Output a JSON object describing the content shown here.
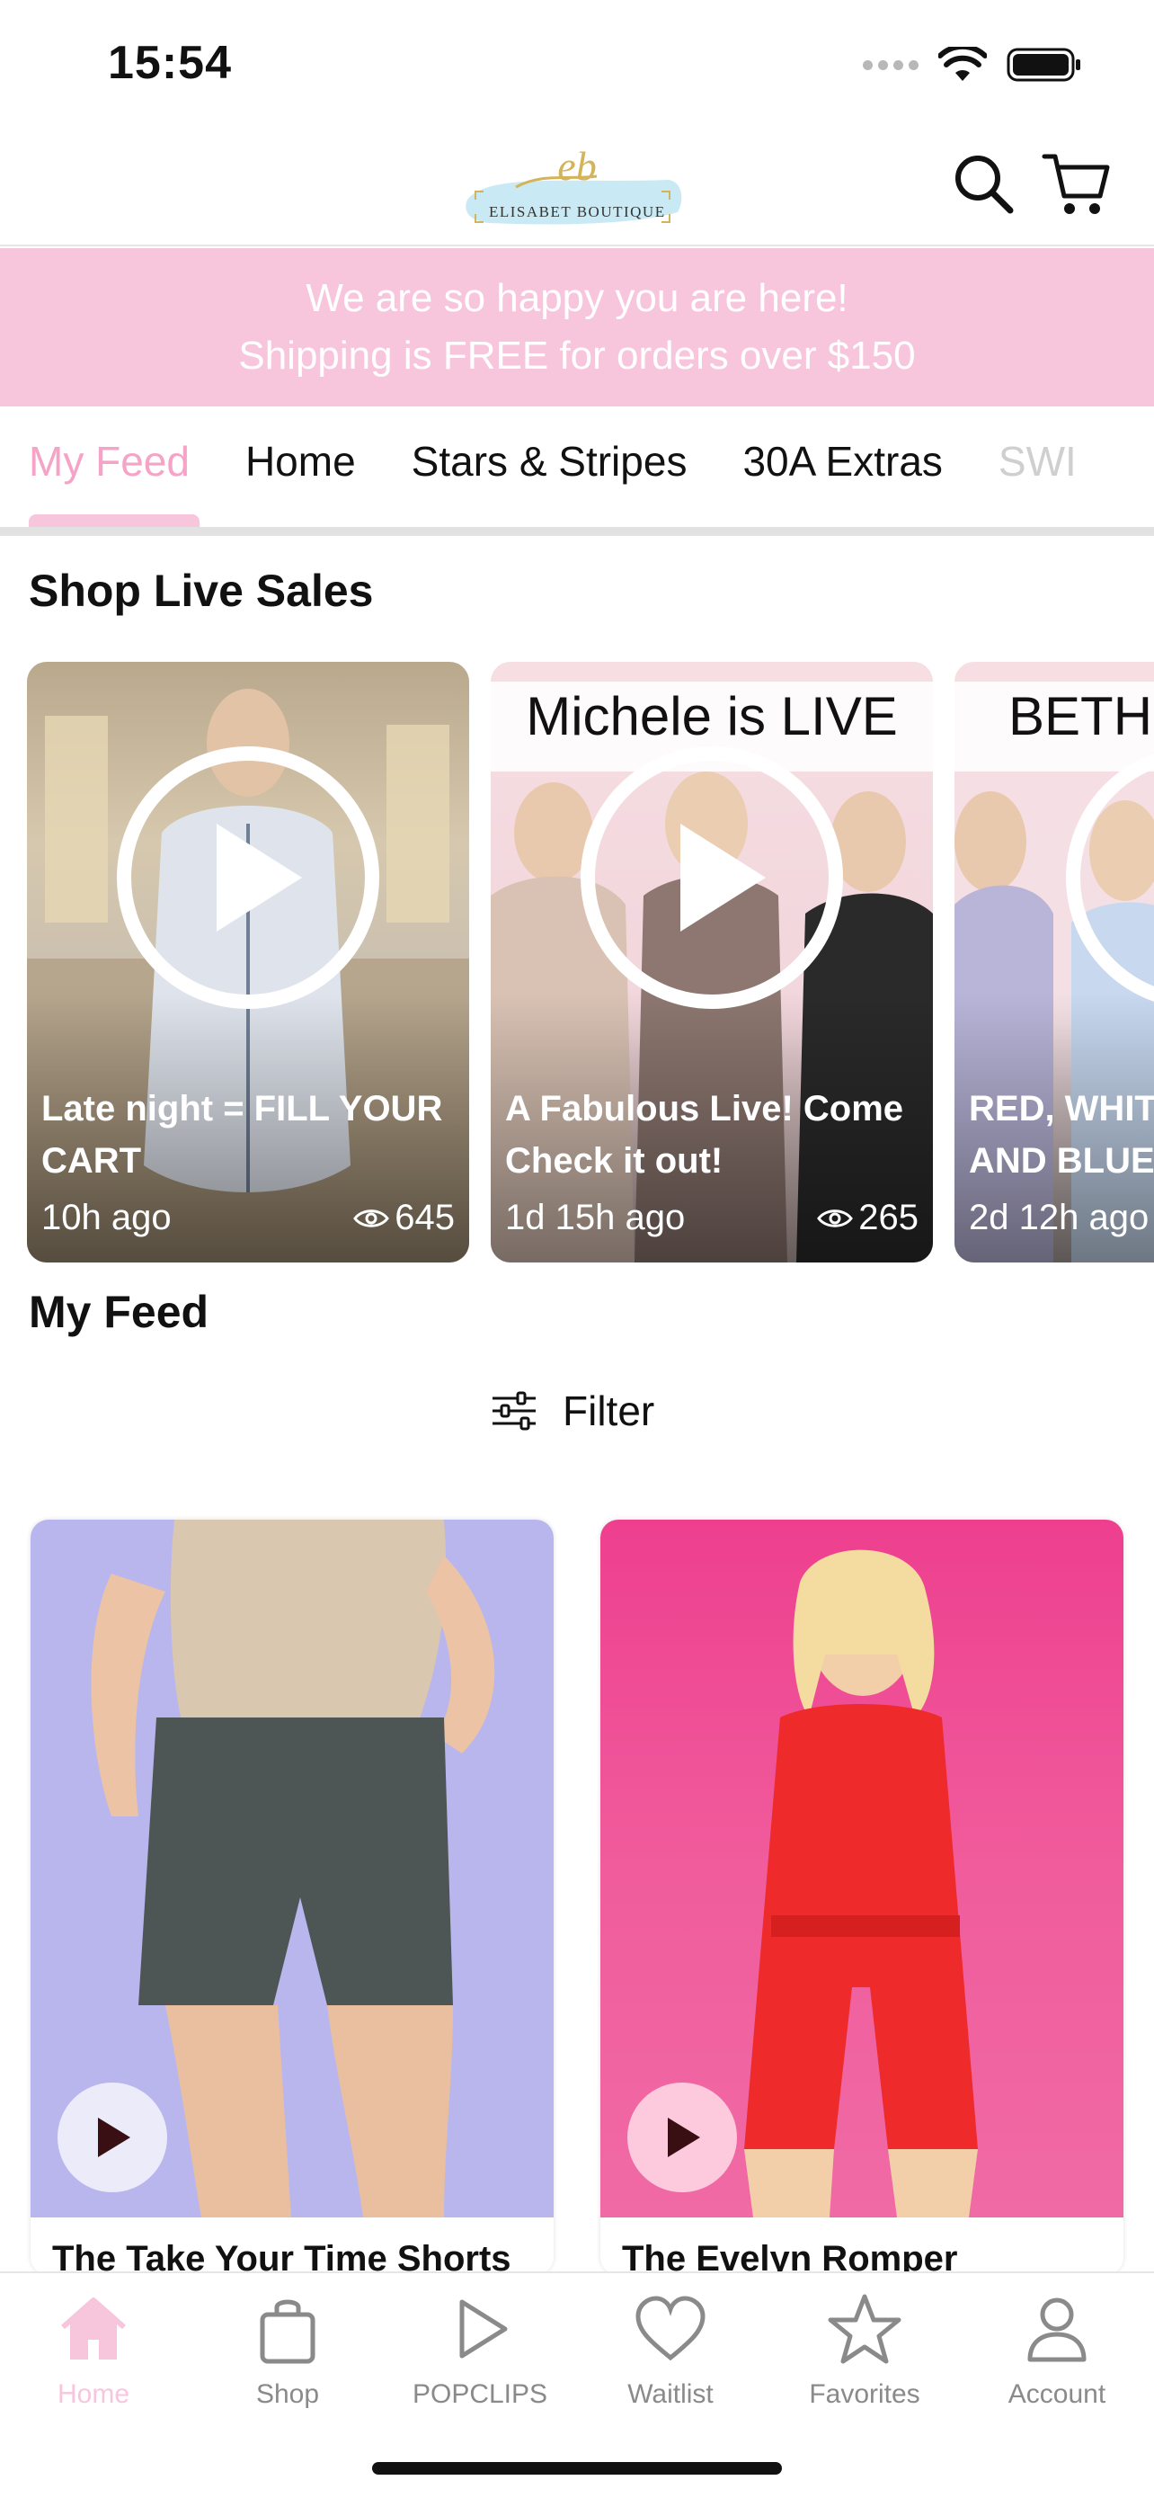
{
  "status_bar": {
    "time": "15:54"
  },
  "brand": {
    "logo_monogram": "eb",
    "logo_text": "ELISABET BOUTIQUE",
    "accent_pink": "#f8c6dc",
    "active_pink": "#f5a3c7"
  },
  "banner": {
    "line1": "We are so happy you are here!",
    "line2": "Shipping is FREE for orders over $150"
  },
  "tabs": [
    {
      "label": "My Feed",
      "active": true
    },
    {
      "label": "Home"
    },
    {
      "label": "Stars & Stripes"
    },
    {
      "label": "30A Extras"
    },
    {
      "label": "SWI"
    }
  ],
  "live_sales": {
    "title": "Shop Live Sales",
    "items": [
      {
        "caption": "Late night = FILL YOUR CART",
        "time": "10h ago",
        "views": "645",
        "headline": ""
      },
      {
        "caption": "A Fabulous Live! Come Check it out!",
        "time": "1d 15h ago",
        "views": "265",
        "headline": "Michele is LIVE"
      },
      {
        "caption": "RED, WHIT AND BLUE",
        "time": "2d 12h ago",
        "views": "",
        "headline": "BETH"
      }
    ]
  },
  "feed": {
    "title": "My Feed",
    "filter_label": "Filter",
    "products": [
      {
        "name": "The Take Your Time Shorts"
      },
      {
        "name": "The Evelyn Romper"
      }
    ]
  },
  "bottom_nav": [
    {
      "label": "Home",
      "icon": "home-icon",
      "active": true
    },
    {
      "label": "Shop",
      "icon": "shopping-bag-icon"
    },
    {
      "label": "POPCLIPS",
      "icon": "play-icon"
    },
    {
      "label": "Waitlist",
      "icon": "heart-icon"
    },
    {
      "label": "Favorites",
      "icon": "star-icon"
    },
    {
      "label": "Account",
      "icon": "user-icon"
    }
  ]
}
